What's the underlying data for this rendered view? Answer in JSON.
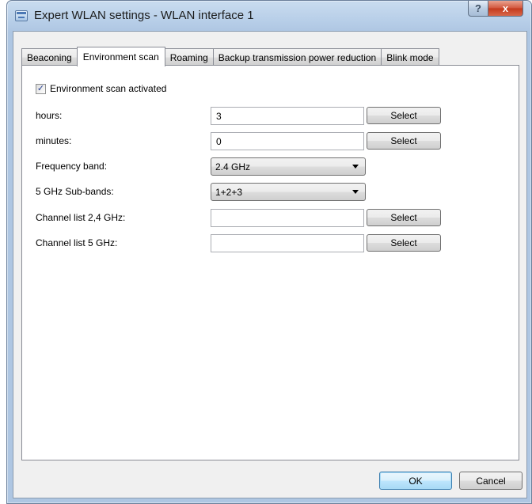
{
  "window": {
    "title": "Expert WLAN settings - WLAN interface 1",
    "help_label": "?",
    "close_label": "x"
  },
  "tabs": [
    {
      "label": "Beaconing",
      "active": false
    },
    {
      "label": "Environment scan",
      "active": true
    },
    {
      "label": "Roaming",
      "active": false
    },
    {
      "label": "Backup transmission power reduction",
      "active": false
    },
    {
      "label": "Blink mode",
      "active": false
    }
  ],
  "scan": {
    "activated_label": "Environment scan activated",
    "activated_checked": true,
    "check_glyph": "✓",
    "hours_label": "hours:",
    "hours_value": "3",
    "minutes_label": "minutes:",
    "minutes_value": "0",
    "freq_band_label": "Frequency band:",
    "freq_band_value": "2.4 GHz",
    "subbands_label": "5 GHz Sub-bands:",
    "subbands_value": "1+2+3",
    "channel24_label": "Channel list 2,4 GHz:",
    "channel24_value": "",
    "channel5_label": "Channel list 5 GHz:",
    "channel5_value": "",
    "select_label": "Select"
  },
  "footer": {
    "ok_label": "OK",
    "cancel_label": "Cancel"
  }
}
